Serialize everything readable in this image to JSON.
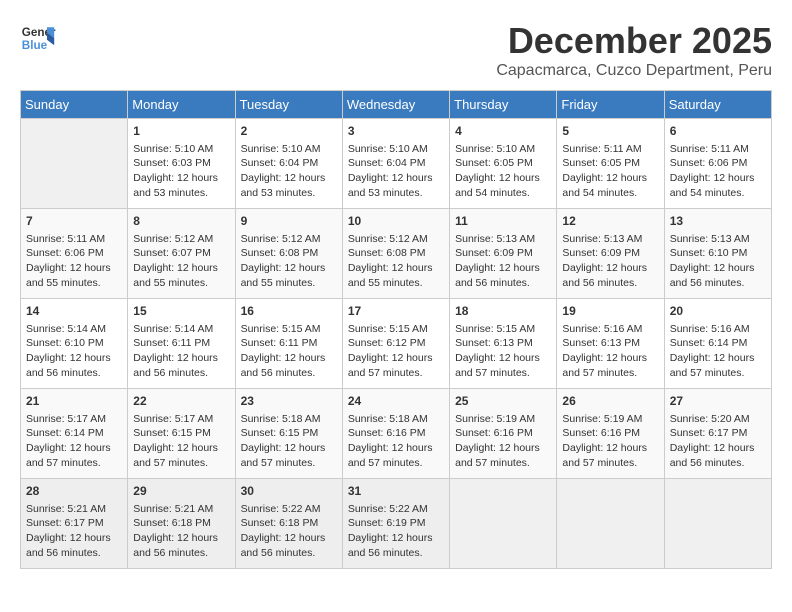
{
  "logo": {
    "line1": "General",
    "line2": "Blue"
  },
  "title": "December 2025",
  "subtitle": "Capacmarca, Cuzco Department, Peru",
  "days_of_week": [
    "Sunday",
    "Monday",
    "Tuesday",
    "Wednesday",
    "Thursday",
    "Friday",
    "Saturday"
  ],
  "weeks": [
    [
      {
        "day": "",
        "content": ""
      },
      {
        "day": "1",
        "content": "Sunrise: 5:10 AM\nSunset: 6:03 PM\nDaylight: 12 hours\nand 53 minutes."
      },
      {
        "day": "2",
        "content": "Sunrise: 5:10 AM\nSunset: 6:04 PM\nDaylight: 12 hours\nand 53 minutes."
      },
      {
        "day": "3",
        "content": "Sunrise: 5:10 AM\nSunset: 6:04 PM\nDaylight: 12 hours\nand 53 minutes."
      },
      {
        "day": "4",
        "content": "Sunrise: 5:10 AM\nSunset: 6:05 PM\nDaylight: 12 hours\nand 54 minutes."
      },
      {
        "day": "5",
        "content": "Sunrise: 5:11 AM\nSunset: 6:05 PM\nDaylight: 12 hours\nand 54 minutes."
      },
      {
        "day": "6",
        "content": "Sunrise: 5:11 AM\nSunset: 6:06 PM\nDaylight: 12 hours\nand 54 minutes."
      }
    ],
    [
      {
        "day": "7",
        "content": "Sunrise: 5:11 AM\nSunset: 6:06 PM\nDaylight: 12 hours\nand 55 minutes."
      },
      {
        "day": "8",
        "content": "Sunrise: 5:12 AM\nSunset: 6:07 PM\nDaylight: 12 hours\nand 55 minutes."
      },
      {
        "day": "9",
        "content": "Sunrise: 5:12 AM\nSunset: 6:08 PM\nDaylight: 12 hours\nand 55 minutes."
      },
      {
        "day": "10",
        "content": "Sunrise: 5:12 AM\nSunset: 6:08 PM\nDaylight: 12 hours\nand 55 minutes."
      },
      {
        "day": "11",
        "content": "Sunrise: 5:13 AM\nSunset: 6:09 PM\nDaylight: 12 hours\nand 56 minutes."
      },
      {
        "day": "12",
        "content": "Sunrise: 5:13 AM\nSunset: 6:09 PM\nDaylight: 12 hours\nand 56 minutes."
      },
      {
        "day": "13",
        "content": "Sunrise: 5:13 AM\nSunset: 6:10 PM\nDaylight: 12 hours\nand 56 minutes."
      }
    ],
    [
      {
        "day": "14",
        "content": "Sunrise: 5:14 AM\nSunset: 6:10 PM\nDaylight: 12 hours\nand 56 minutes."
      },
      {
        "day": "15",
        "content": "Sunrise: 5:14 AM\nSunset: 6:11 PM\nDaylight: 12 hours\nand 56 minutes."
      },
      {
        "day": "16",
        "content": "Sunrise: 5:15 AM\nSunset: 6:11 PM\nDaylight: 12 hours\nand 56 minutes."
      },
      {
        "day": "17",
        "content": "Sunrise: 5:15 AM\nSunset: 6:12 PM\nDaylight: 12 hours\nand 57 minutes."
      },
      {
        "day": "18",
        "content": "Sunrise: 5:15 AM\nSunset: 6:13 PM\nDaylight: 12 hours\nand 57 minutes."
      },
      {
        "day": "19",
        "content": "Sunrise: 5:16 AM\nSunset: 6:13 PM\nDaylight: 12 hours\nand 57 minutes."
      },
      {
        "day": "20",
        "content": "Sunrise: 5:16 AM\nSunset: 6:14 PM\nDaylight: 12 hours\nand 57 minutes."
      }
    ],
    [
      {
        "day": "21",
        "content": "Sunrise: 5:17 AM\nSunset: 6:14 PM\nDaylight: 12 hours\nand 57 minutes."
      },
      {
        "day": "22",
        "content": "Sunrise: 5:17 AM\nSunset: 6:15 PM\nDaylight: 12 hours\nand 57 minutes."
      },
      {
        "day": "23",
        "content": "Sunrise: 5:18 AM\nSunset: 6:15 PM\nDaylight: 12 hours\nand 57 minutes."
      },
      {
        "day": "24",
        "content": "Sunrise: 5:18 AM\nSunset: 6:16 PM\nDaylight: 12 hours\nand 57 minutes."
      },
      {
        "day": "25",
        "content": "Sunrise: 5:19 AM\nSunset: 6:16 PM\nDaylight: 12 hours\nand 57 minutes."
      },
      {
        "day": "26",
        "content": "Sunrise: 5:19 AM\nSunset: 6:16 PM\nDaylight: 12 hours\nand 57 minutes."
      },
      {
        "day": "27",
        "content": "Sunrise: 5:20 AM\nSunset: 6:17 PM\nDaylight: 12 hours\nand 56 minutes."
      }
    ],
    [
      {
        "day": "28",
        "content": "Sunrise: 5:21 AM\nSunset: 6:17 PM\nDaylight: 12 hours\nand 56 minutes."
      },
      {
        "day": "29",
        "content": "Sunrise: 5:21 AM\nSunset: 6:18 PM\nDaylight: 12 hours\nand 56 minutes."
      },
      {
        "day": "30",
        "content": "Sunrise: 5:22 AM\nSunset: 6:18 PM\nDaylight: 12 hours\nand 56 minutes."
      },
      {
        "day": "31",
        "content": "Sunrise: 5:22 AM\nSunset: 6:19 PM\nDaylight: 12 hours\nand 56 minutes."
      },
      {
        "day": "",
        "content": ""
      },
      {
        "day": "",
        "content": ""
      },
      {
        "day": "",
        "content": ""
      }
    ]
  ]
}
